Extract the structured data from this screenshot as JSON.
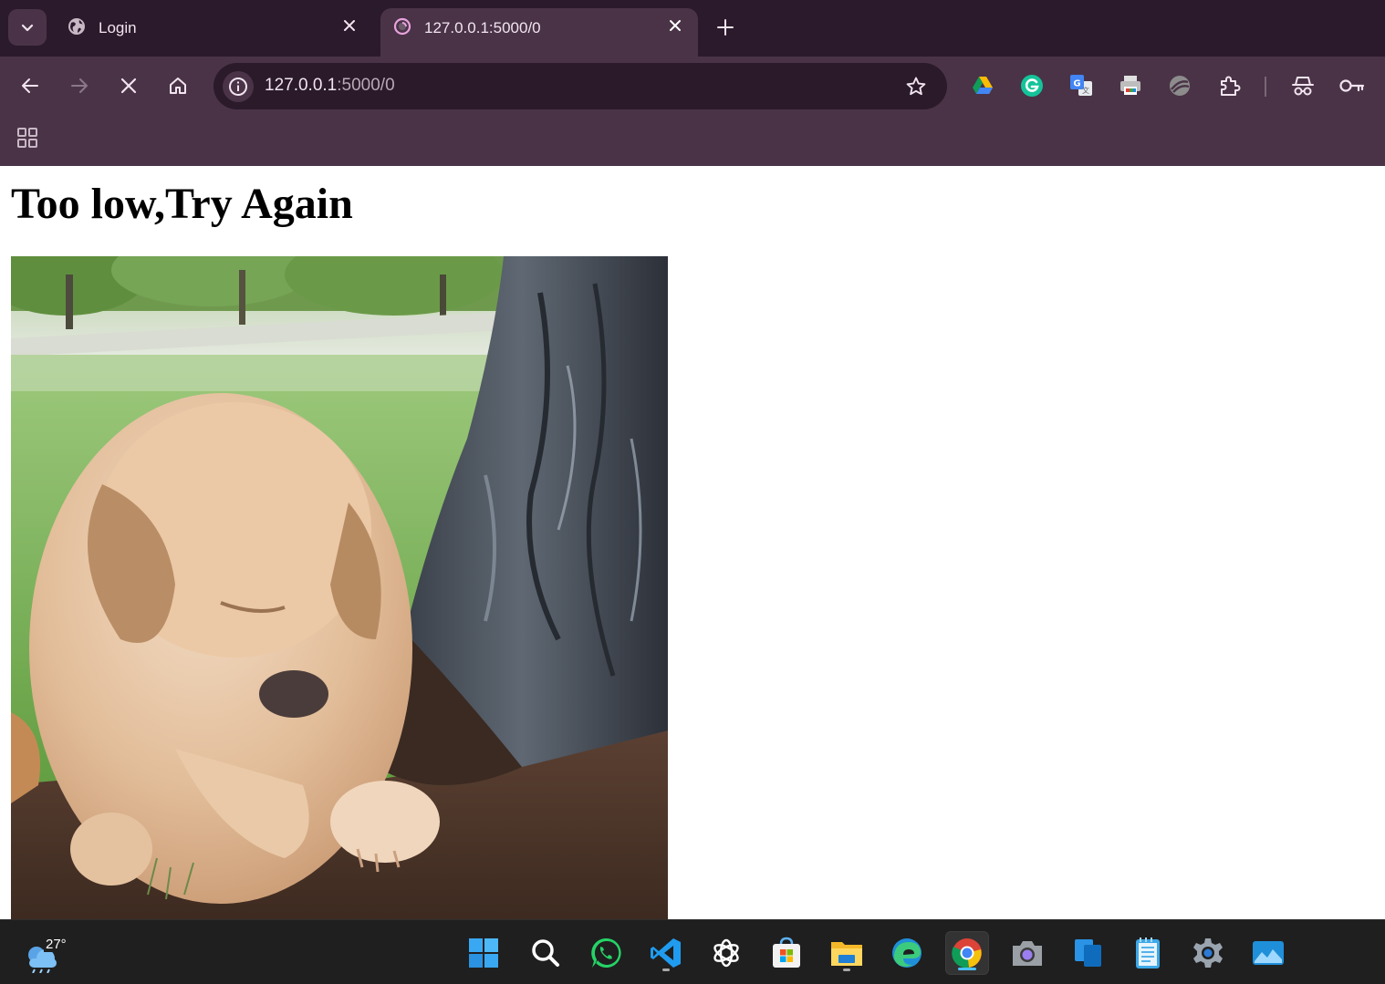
{
  "browser": {
    "tabs": [
      {
        "title": "Login",
        "active": false
      },
      {
        "title": "127.0.0.1:5000/0",
        "active": true
      }
    ],
    "address_bar": {
      "host": "127.0.0.1",
      "path": ":5000/0"
    },
    "toolbar_icons": [
      "back-icon",
      "forward-icon",
      "stop-icon",
      "home-icon",
      "site-info-icon",
      "bookmark-star-icon"
    ],
    "extensions": [
      "google-drive-icon",
      "grammarly-icon",
      "google-translate-icon",
      "print-friendly-icon",
      "vpn-extension-icon",
      "extensions-puzzle-icon",
      "incognito-icon",
      "password-key-icon"
    ]
  },
  "page": {
    "heading": "Too low,Try Again",
    "image_description_icon": "puppy-digging-gif"
  },
  "taskbar": {
    "weather_temp": "27°",
    "apps": [
      "start-icon",
      "search-icon",
      "whatsapp-icon",
      "vscode-icon",
      "chatgpt-icon",
      "microsoft-store-icon",
      "file-explorer-icon",
      "edge-icon",
      "chrome-icon",
      "camera-icon",
      "windows-app-icon",
      "notepad-icon",
      "settings-icon",
      "photos-icon"
    ]
  },
  "colors": {
    "tabstrip": "#2b1a2b",
    "toolbar": "#4a3347",
    "omnibox": "#2a1a2a",
    "taskbar": "#1f1f1f"
  }
}
